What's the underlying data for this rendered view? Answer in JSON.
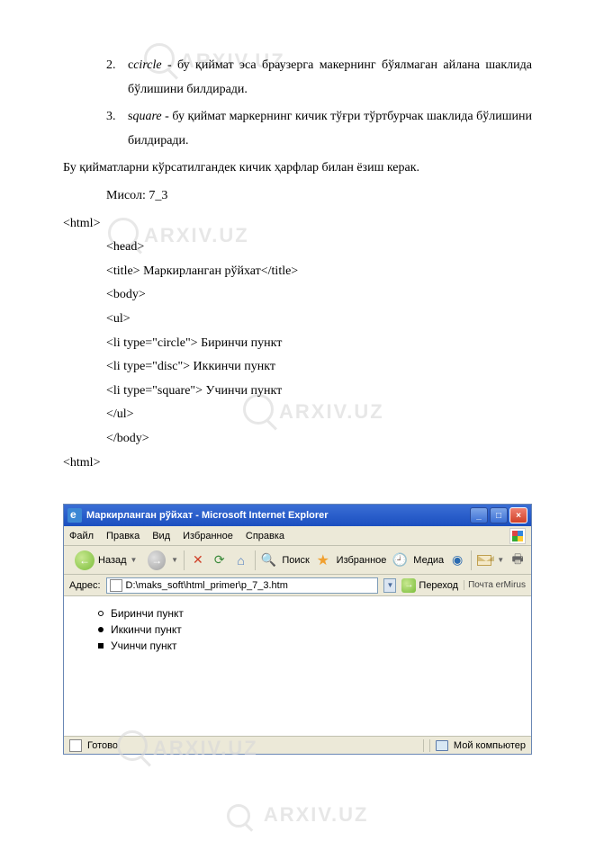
{
  "watermark": "ARXIV.UZ",
  "list": {
    "item2": {
      "num": "2.",
      "term": "circle",
      "prefix": "c",
      "text": " - бу қиймат эса браузерга макернинг бўялмаган айлана шаклида бўлишини билдиради."
    },
    "item3": {
      "num": "3.",
      "term": "quare",
      "prefix": "s",
      "text": " - бу қиймат маркернинг кичик тўғри тўртбурчак шаклида бўлишини билдиради."
    }
  },
  "para1": "Бу қийматларни кўрсатилгандек кичик ҳарфлар билан ёзиш керак.",
  "example_label": "Мисол: 7_3",
  "code": {
    "l1": "<html>",
    "l2": "<head>",
    "l3": "<title> Маркирланган рўйхат</title>",
    "l4": "<body>",
    "l5": "<ul>",
    "l6": "<li type=\"circle\"> Биринчи пункт",
    "l7": "<li type=\"disc\">  Иккинчи пункт",
    "l8": "<li type=\"square\"> Учинчи пункт",
    "l9": "</ul>",
    "l10": "</body>",
    "l11": "<html>"
  },
  "ie": {
    "title": "Маркирланган рўйхат - Microsoft Internet Explorer",
    "menu": {
      "file": "Файл",
      "edit": "Правка",
      "view": "Вид",
      "fav": "Избранное",
      "help": "Справка"
    },
    "toolbar": {
      "back": "Назад",
      "search": "Поиск",
      "favorites": "Избранное",
      "media": "Медиа"
    },
    "address": {
      "label": "Адрес:",
      "value": "D:\\maks_soft\\html_primer\\p_7_3.htm",
      "go": "Переход",
      "software": "Почта erMirus"
    },
    "body": {
      "li1": "Биринчи пункт",
      "li2": "Иккинчи пункт",
      "li3": "Учинчи пункт"
    },
    "status": {
      "done": "Готово",
      "zone": "Мой компьютер"
    }
  }
}
